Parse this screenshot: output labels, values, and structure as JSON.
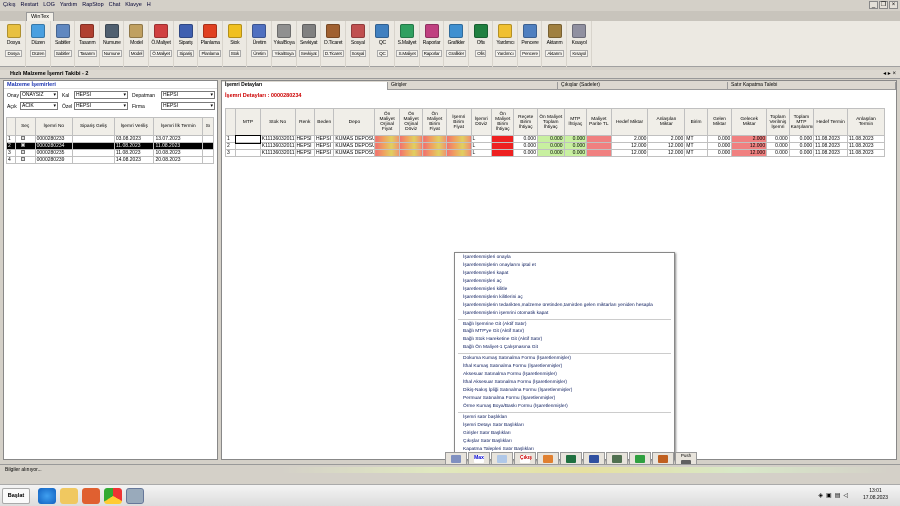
{
  "menu": [
    "Çıkış",
    "Restart",
    "LOG",
    "Yardım",
    "RapStop",
    "Chat",
    "Klavye",
    "H"
  ],
  "app_tab": "WinTex",
  "toolbar": [
    {
      "label": "Dosya",
      "sub": "Dosya",
      "color": "#e8c040"
    },
    {
      "label": "Düzen",
      "sub": "Düzen",
      "color": "#4aa0e0"
    },
    {
      "label": "Sabitler",
      "sub": "Sabitler",
      "color": "#6088c0"
    },
    {
      "label": "Tasarım",
      "sub": "Tasarım",
      "color": "#b04030"
    },
    {
      "label": "Numune",
      "sub": "Numune",
      "color": "#506070"
    },
    {
      "label": "Model",
      "sub": "Model",
      "color": "#c0a060"
    },
    {
      "label": "Ö.Maliyet",
      "sub": "Ö.Maliyet",
      "color": "#d04040"
    },
    {
      "label": "Sipariş",
      "sub": "Sipariş",
      "color": "#4060b0"
    },
    {
      "label": "Planlama",
      "sub": "Planlama",
      "color": "#e04020"
    },
    {
      "label": "Stok",
      "sub": "Stok",
      "color": "#f0c020"
    },
    {
      "label": "Üretim",
      "sub": "Üretim",
      "color": "#5070c0"
    },
    {
      "label": "Yıka/Boya",
      "sub": "Yıka/Boya",
      "color": "#909090"
    },
    {
      "label": "Sevkiyat",
      "sub": "Sevkiyat",
      "color": "#808080"
    },
    {
      "label": "D.Ticaret",
      "sub": "D.Ticaret",
      "color": "#a06030"
    },
    {
      "label": "Sosyal",
      "sub": "Sosyal",
      "color": "#c05050"
    },
    {
      "label": "QC",
      "sub": "QC",
      "color": "#4080c0"
    },
    {
      "label": "S.Maliyet",
      "sub": "S.Maliyet",
      "color": "#30a060"
    },
    {
      "label": "Raporlar",
      "sub": "Raporlar",
      "color": "#c04080"
    },
    {
      "label": "Grafikler",
      "sub": "Grafikler",
      "color": "#4090d0"
    },
    {
      "label": "Ofis",
      "sub": "Ofis",
      "color": "#208040"
    },
    {
      "label": "Yardımcı",
      "sub": "Yardımcı",
      "color": "#f0c030"
    },
    {
      "label": "Pencere",
      "sub": "Pencere",
      "color": "#5080c0"
    },
    {
      "label": "Aktarım",
      "sub": "Aktarım",
      "color": "#a08040"
    },
    {
      "label": "Kısayol",
      "sub": "Kısayol",
      "color": "#9090a0"
    }
  ],
  "doc_title": "Hızlı Malzeme İşemri Takibi - 2",
  "left": {
    "header": "Malzeme İşemirleri",
    "filters": {
      "onay_label": "Onay",
      "onay_value": "ONAYSIZ",
      "kal_label": "Kal",
      "kal_value": "HEPSI",
      "depatman_label": "Depatman",
      "depatman_value": "HEPSI",
      "acik_label": "Açık",
      "acik_value": "ACIK",
      "ozel_label": "Özel",
      "ozel_value": "HEPSI",
      "firma_label": "Firma",
      "firma_value": "HEPSI"
    },
    "columns": [
      "",
      "Seç",
      "İşemri No",
      "Sipariş Geliş",
      "İşemri Veriliş",
      "İşemri İlk Termin",
      "Sı"
    ],
    "rows": [
      {
        "n": "1",
        "no": "0000280233",
        "gelis": "",
        "veris": "03.08.2023",
        "termin": "13.07.2023"
      },
      {
        "n": "2",
        "no": "0000280234",
        "gelis": "",
        "veris": "11.08.2023",
        "termin": "11.08.2023"
      },
      {
        "n": "3",
        "no": "0000280235",
        "gelis": "",
        "veris": "11.08.2023",
        "termin": "10.08.2023"
      },
      {
        "n": "4",
        "no": "0000280239",
        "gelis": "",
        "veris": "14.08.2023",
        "termin": "20.08.2023"
      }
    ]
  },
  "right": {
    "tabs": [
      "İşemri Detayları",
      "Girişler",
      "Çıkışlar (Sadeler)",
      "Satır Kapatma Talebi"
    ],
    "subtitle": "İşemri Detayları : 0000280234",
    "columns": [
      "",
      "MTP",
      "Stok No",
      "Renk",
      "Beden",
      "Depo",
      "Ön Maliyet Orjinal Fiyat",
      "Ön Maliyet Orjinal Döviz",
      "Ön Maliyet Birim Fiyat",
      "İşemri Birim Fiyat",
      "İşemri Döviz",
      "Ön Maliyet Birim İhtiyaç",
      "Reçete Birim İhtiyaç",
      "Ön Maliyet Toplam İhtiyaç",
      "MTP İhtiyaç",
      "Maliyet Parite TL",
      "Hedef Miktar",
      "Anlaşılan Miktar",
      "Birim",
      "Gelen Miktar",
      "Gelecek Miktar",
      "Toplam Verilmiş İşemri",
      "Toplam MTP Karşılanmış",
      "Hedef Termin",
      "Anlaşılan Termin"
    ],
    "rows": [
      {
        "n": "1",
        "stok": "K11136032011",
        "renk": "HEPSI",
        "beden": "HEPSI",
        "depo": "KUMAS DEPOSU",
        "doviz": "L",
        "recete": "0.000",
        "ontop": "0.000",
        "mtp": "0.000",
        "hedef": "2.000",
        "anl": "2.000",
        "birim": "MT",
        "gelen": "0.000",
        "gelecek": "2.000",
        "topv": "0.000",
        "topm": "0.000",
        "ht": "11.08.2023",
        "at": "11.08.2023"
      },
      {
        "n": "2",
        "stok": "K11136032011",
        "renk": "HEPSI",
        "beden": "HEPSI",
        "depo": "KUMAS DEPOSU",
        "doviz": "L",
        "recete": "0.000",
        "ontop": "0.000",
        "mtp": "0.000",
        "hedef": "12.000",
        "anl": "12.000",
        "birim": "MT",
        "gelen": "0.000",
        "gelecek": "12.000",
        "topv": "0.000",
        "topm": "0.000",
        "ht": "11.08.2023",
        "at": "11.08.2023"
      },
      {
        "n": "3",
        "stok": "K11136032011",
        "renk": "HEPSI",
        "beden": "HEPSI",
        "depo": "KUMAS DEPOSU",
        "doviz": "L",
        "recete": "0.000",
        "ontop": "0.000",
        "mtp": "0.000",
        "hedef": "12.000",
        "anl": "12.000",
        "birim": "MT",
        "gelen": "0.000",
        "gelecek": "12.000",
        "topv": "0.000",
        "topm": "0.000",
        "ht": "11.08.2023",
        "at": "11.08.2023"
      }
    ]
  },
  "context_menu": {
    "group1": [
      "İşaretlenmişleri onayla",
      "İşaretlenmişlerin onaylarını iptal et",
      "İşaretlenmişleri kapat",
      "İşaretlenmişleri aç",
      "İşaretlenmişleri kilitle",
      "İşaretlenmişlerin kilitlerini aç",
      "İşaretlenmişlerin tedarikten,malzeme üretinden,tamirden gelen miktarları yeniden hesapla",
      "İşaretlenmişlerin işemrini otomatik kapat"
    ],
    "group2": [
      "Bağlı İşemrine Git (Aktif Satır)",
      "Bağlı MTP'ye Git (Aktif Satır)",
      "Bağlı Stok Hareketine Git (Aktif Satır)",
      "Bağlı Ön Maliyet-1 Çalışmasına Git"
    ],
    "group3": [
      "Dokuma Kumaş Satınalma Formu (İşaretlenmişler)",
      "İthal Kumaş Satınalma Formu (İşaretlenmişler)",
      "Aksesuar Satınalma Formu (İşaretlenmişler)",
      "İthal Aksesuar Satınalma Formu (İşaretlenmişler)",
      "Dikiş-Nakış İpliği Satınalma Formu (İşaretlenmişler)",
      "Permuar Satınalma Formu (İşaretlenmişler)",
      "Örme Kumaş Boya/Baskı Formu (İşaretlenmişler)"
    ],
    "group4": [
      "İşemri satır başlıkları",
      "İşemri Detayı Satır Başlıkları",
      "Girişler Satır Başlıkları",
      "Çıkışlar Satır Başlıkları",
      "Kapatma Talepleri Satır Başlıkları"
    ]
  },
  "bottom_buttons": {
    "islemler": "İşlemler",
    "max": "Max",
    "kapat": "Kapat",
    "cikis": "Çıkış",
    "push": "Push"
  },
  "status": "Bilgiler alınıyor...",
  "taskbar": {
    "start": "Başlat",
    "time": "13:01",
    "date": "17.08.2023"
  }
}
